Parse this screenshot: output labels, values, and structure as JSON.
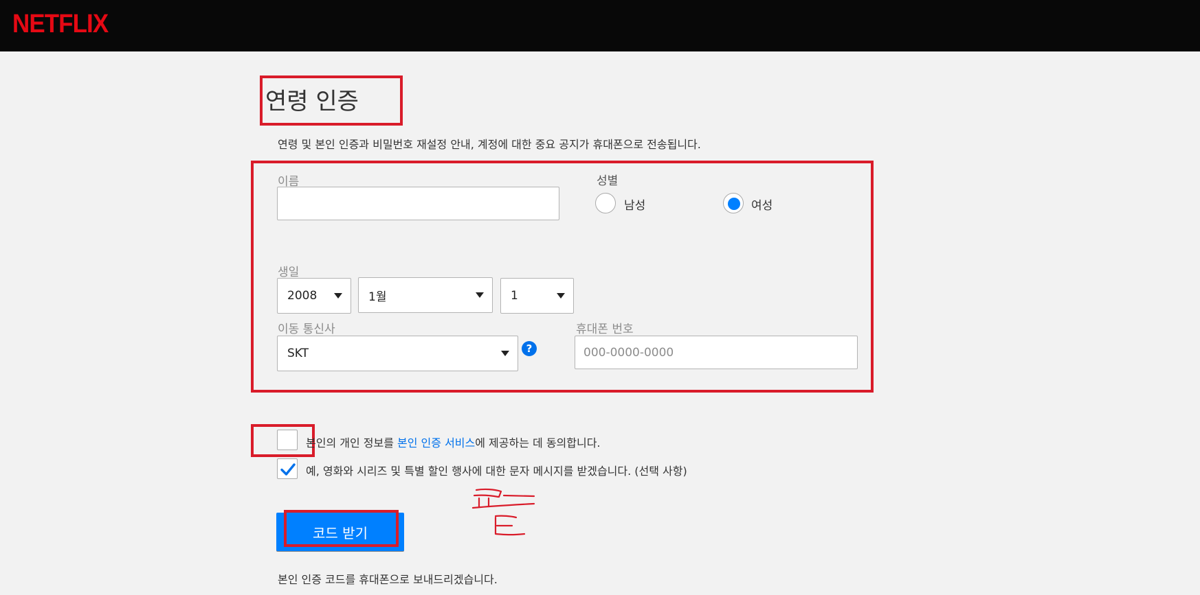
{
  "header": {
    "logo_text": "NETFLIX",
    "logo_color": "#e50914"
  },
  "page": {
    "title": "연령 인증",
    "subtitle": "연령 및 본인 인증과 비밀번호 재설정 안내, 계정에 대한 중요 공지가 휴대폰으로 전송됩니다."
  },
  "form": {
    "name": {
      "label": "이름",
      "value": ""
    },
    "gender": {
      "label": "성별",
      "options": [
        {
          "label": "남성",
          "selected": false
        },
        {
          "label": "여성",
          "selected": true
        }
      ]
    },
    "birthday": {
      "label": "생일",
      "year": "2008",
      "month": "1월",
      "day": "1"
    },
    "carrier": {
      "label": "이동 통신사",
      "value": "SKT",
      "help_icon": "?"
    },
    "phone": {
      "label": "휴대폰 번호",
      "placeholder": "000-0000-0000"
    }
  },
  "consent": {
    "agree_prefix": "본인의 개인 정보를 ",
    "agree_link": "본인 인증 서비스",
    "agree_suffix": "에 제공하는 데 동의합니다.",
    "agree_checked": false,
    "marketing_text": "예, 영화와 시리즈 및 특별 할인 행사에 대한 문자 메시지를 받겠습니다. (선택 사항)",
    "marketing_checked": true
  },
  "actions": {
    "submit_label": "코드 받기"
  },
  "footnote": "본인 인증 코드를 휴대폰으로 보내드리겠습니다.",
  "colors": {
    "accent": "#0080ff",
    "annotation_red": "#d91c2a",
    "background": "#f2f2f2"
  }
}
